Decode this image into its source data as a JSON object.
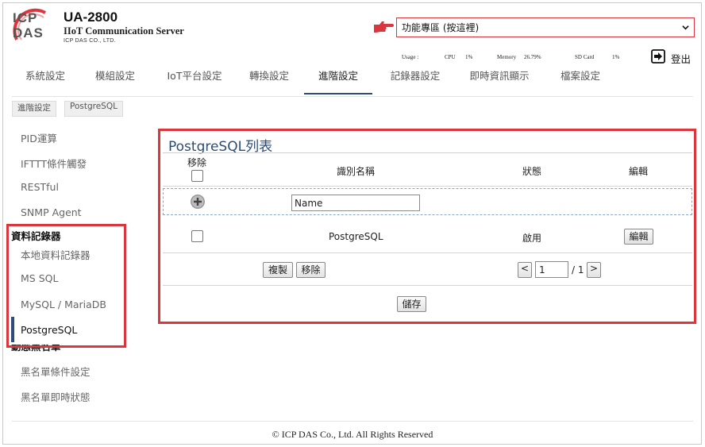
{
  "header": {
    "logo_top": "ICP",
    "logo_bottom": "DAS",
    "title": "UA-2800",
    "subtitle": "IIoT Communication Server",
    "company": "ICP DAS CO., LTD.",
    "function_select": "功能專區 (按這裡)",
    "usage": {
      "label": "Usage :",
      "cpu_label": "CPU",
      "cpu_value": "1%",
      "memory_label": "Memory",
      "memory_value": "26.79%",
      "sdcard_label": "SD Card",
      "sdcard_value": "1%"
    },
    "logout_label": "登出"
  },
  "tabs": [
    {
      "label": "系統設定"
    },
    {
      "label": "模組設定"
    },
    {
      "label": "IoT平台設定"
    },
    {
      "label": "轉換設定"
    },
    {
      "label": "進階設定",
      "active": true
    },
    {
      "label": "記錄器設定"
    },
    {
      "label": "即時資訊顯示"
    },
    {
      "label": "檔案設定"
    }
  ],
  "breadcrumb": [
    "進階設定",
    "PostgreSQL"
  ],
  "sidebar": {
    "items_top": [
      "PID運算",
      "IFTTT條件觸發",
      "RESTful",
      "SNMP Agent"
    ],
    "group1_title": "資料記錄器",
    "group1_items": [
      "本地資料記錄器",
      "MS SQL",
      "MySQL / MariaDB",
      "PostgreSQL"
    ],
    "group2_title": "動態黑名單",
    "group2_items": [
      "黑名單條件設定",
      "黑名單即時狀態"
    ]
  },
  "panel": {
    "title": "PostgreSQL列表",
    "columns": {
      "remove": "移除",
      "name": "識別名稱",
      "status": "狀態",
      "edit": "編輯"
    },
    "new_name_value": "Name",
    "rows": [
      {
        "name": "PostgreSQL",
        "status": "啟用",
        "edit_label": "編輯"
      }
    ],
    "copy_label": "複製",
    "remove_label": "移除",
    "prev_label": "<",
    "page_value": "1",
    "page_total": "/ 1",
    "next_label": ">",
    "save_label": "儲存"
  },
  "footer": "© ICP DAS Co., Ltd. All Rights Reserved",
  "colors": {
    "accent": "#2e4d75",
    "highlight": "#d9363e"
  }
}
